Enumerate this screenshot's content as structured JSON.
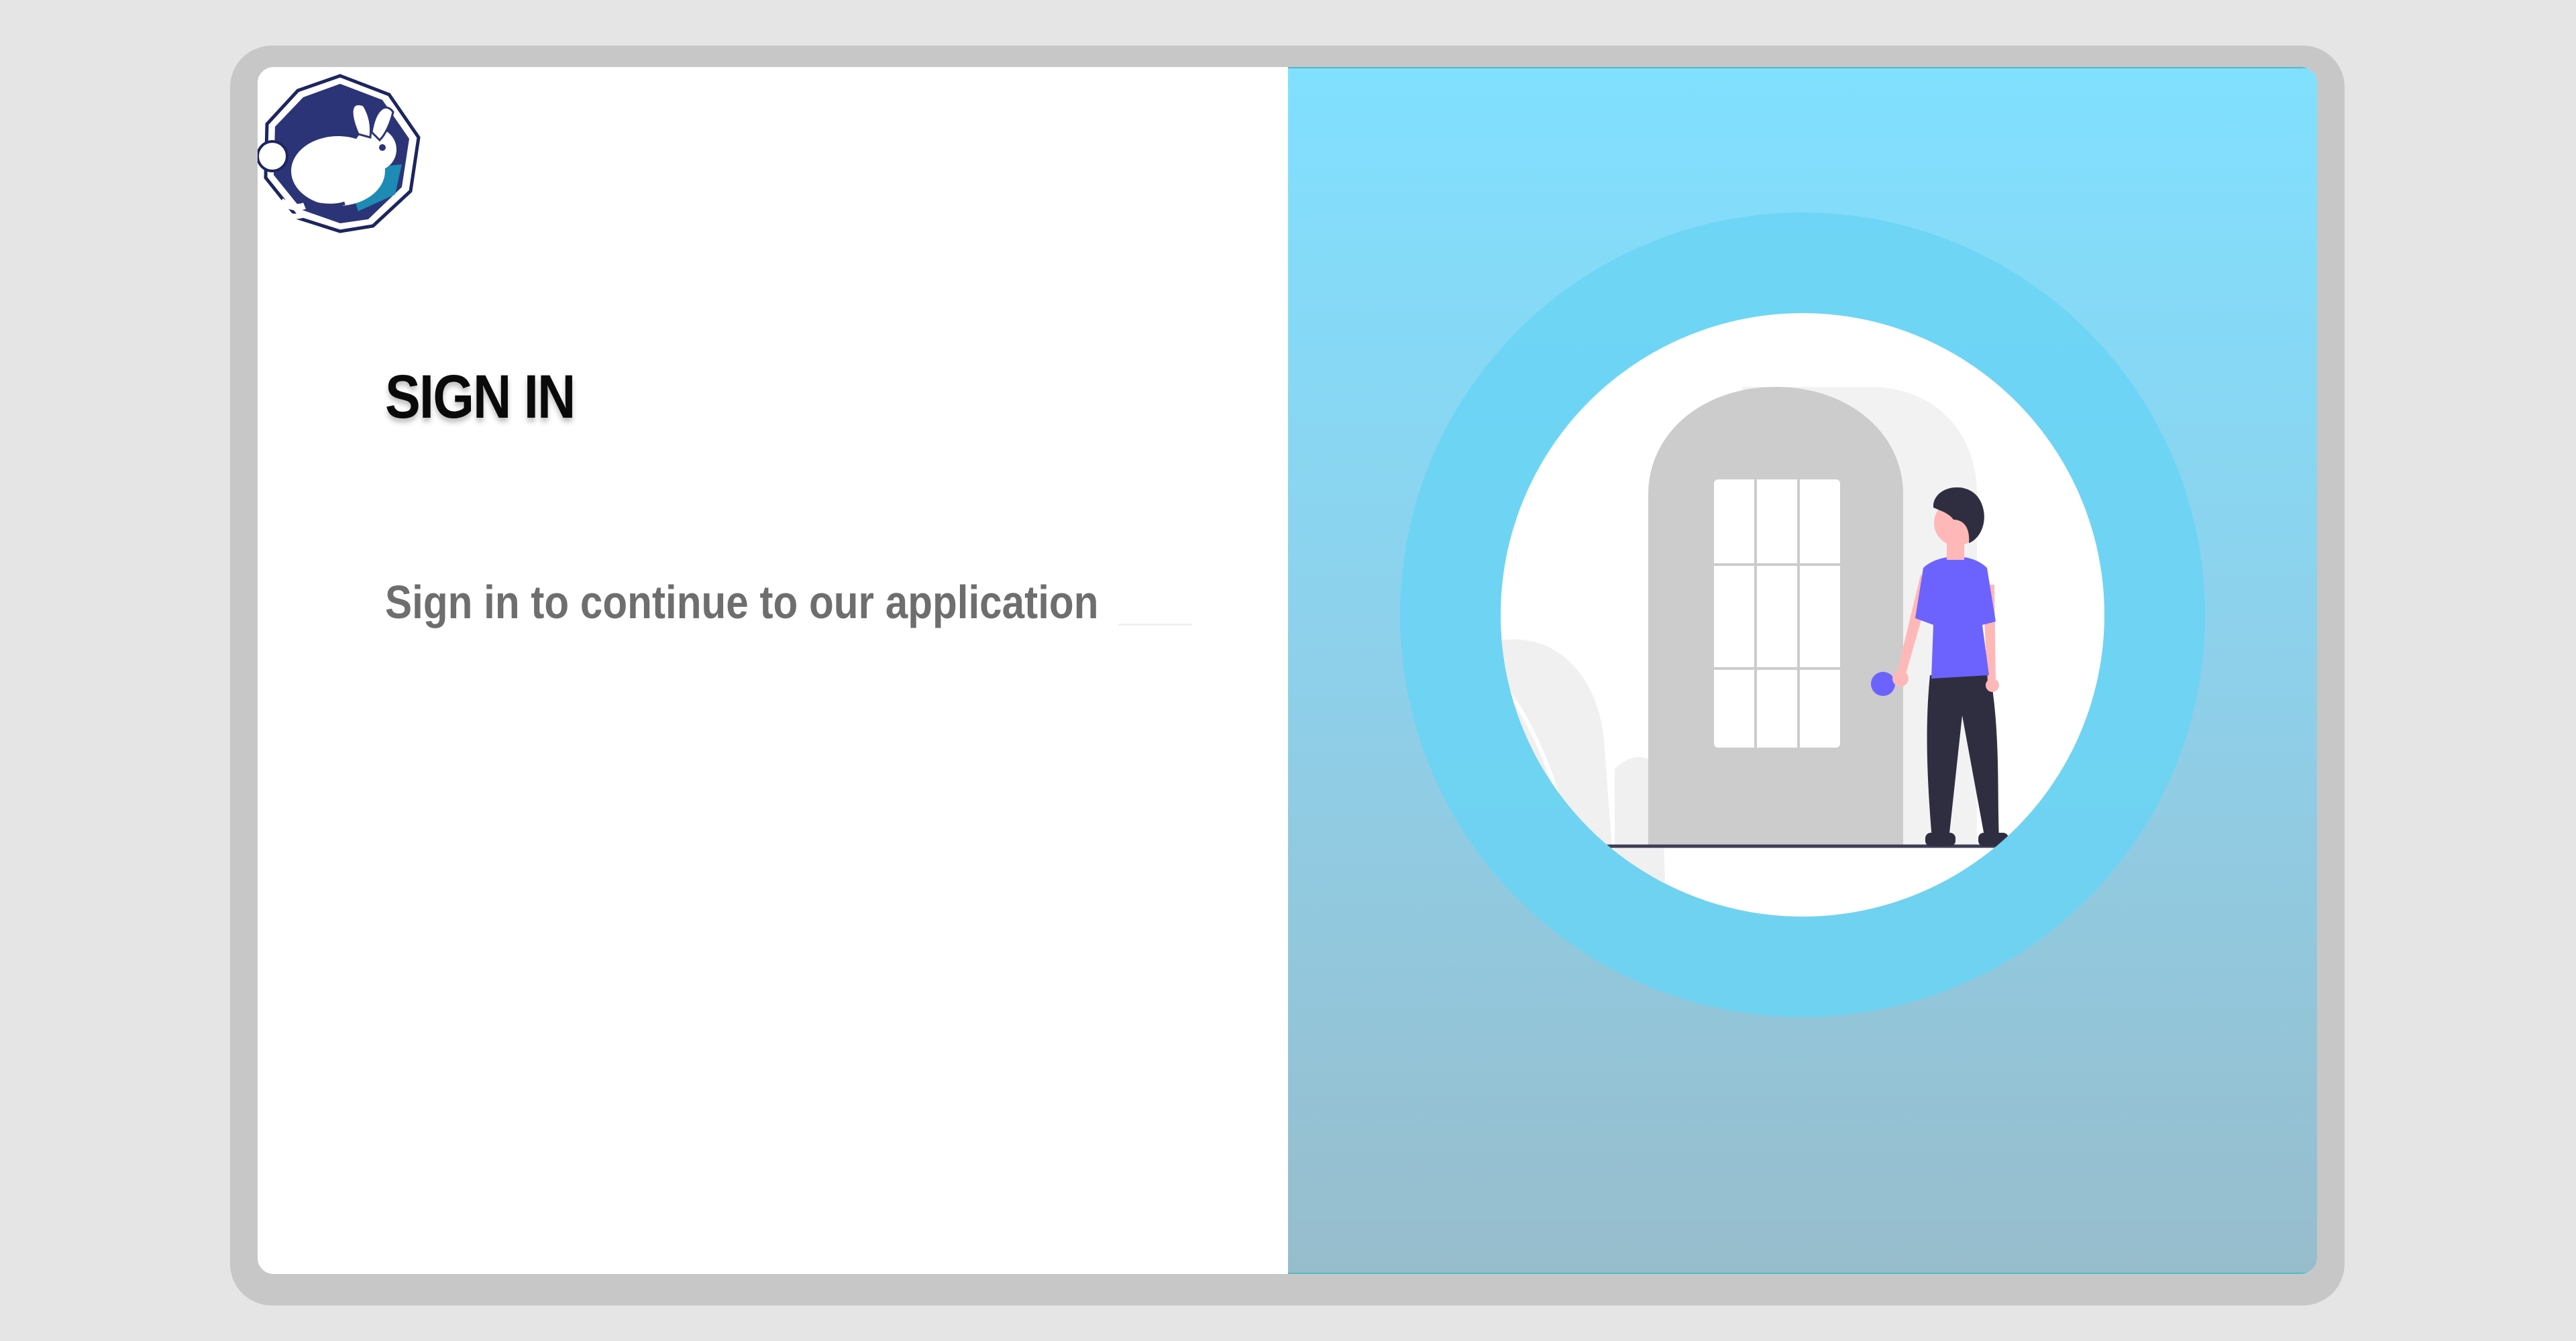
{
  "login": {
    "title": "SIGN IN",
    "subtitle": "Sign in to continue to our application"
  },
  "brand": {
    "logo_icon": "rabbit-logo-icon",
    "logo_colors": [
      "#2c3478",
      "#1d8bb4"
    ]
  },
  "illustration": {
    "icon": "person-at-door-illustration",
    "ring_color": "#6ad4f5",
    "accent_color": "#6c63ff"
  },
  "colors": {
    "background": "#e5e5e5",
    "frame": "#c7c7c7",
    "panel_gradient_top": "#80e0ff",
    "panel_gradient_bottom": "#97bdcc"
  }
}
